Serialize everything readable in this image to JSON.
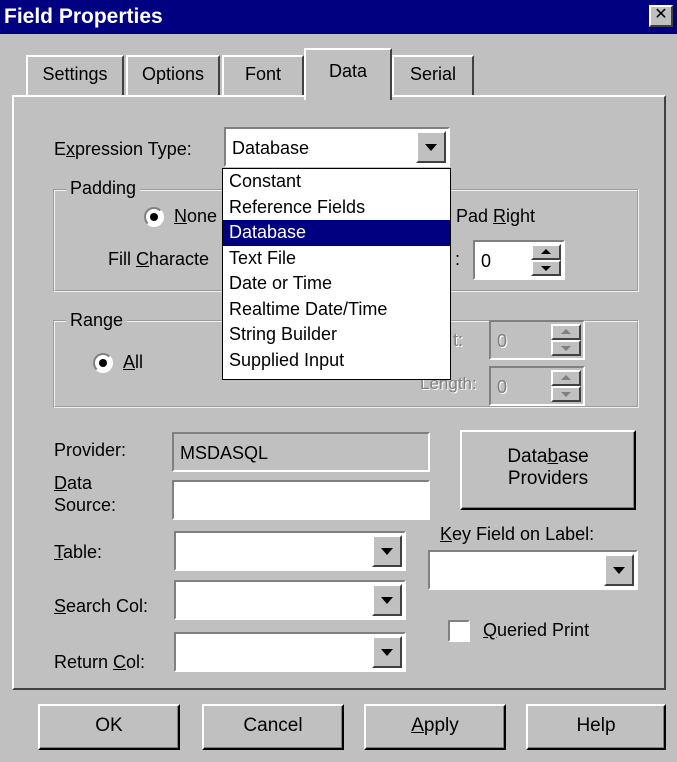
{
  "window": {
    "title": "Field Properties",
    "close_glyph": "✕"
  },
  "tabs": [
    "Settings",
    "Options",
    "Font",
    "Data",
    "Serial"
  ],
  "expression_type": {
    "label_pre": "E",
    "label_u": "x",
    "label_post": "pression Type:",
    "value": "Database",
    "options": [
      "Constant",
      "Reference Fields",
      "Database",
      "Text File",
      "Date or Time",
      "Realtime Date/Time",
      "String Builder",
      "Supplied Input"
    ],
    "selected_index": 2
  },
  "padding": {
    "legend": "Padding",
    "radio_none_u": "N",
    "radio_none_rest": "one",
    "pad_right_pre": "Pad ",
    "pad_right_u": "R",
    "pad_right_rest": "ight",
    "fill_pre": "Fill ",
    "fill_u": "C",
    "fill_rest": "haracte",
    "colon": ":",
    "spin_value": "0"
  },
  "range": {
    "legend": "Range",
    "radio_all_u": "A",
    "radio_all_rest": "ll",
    "start_partial": "t:",
    "start_value": "0",
    "length_label": "Length:",
    "length_value": "0"
  },
  "provider": {
    "label": "Provider:",
    "value": "MSDASQL"
  },
  "data_source": {
    "label_u": "D",
    "label_rest1": "ata",
    "label_line2": "Source:",
    "value": ""
  },
  "database_providers_button": {
    "line1_pre": "Data",
    "line1_u": "b",
    "line1_post": "ase",
    "line2": "Providers"
  },
  "table": {
    "label_u": "T",
    "label_rest": "able:",
    "value": ""
  },
  "search_col": {
    "label_u": "S",
    "label_rest": "earch Col:",
    "value": ""
  },
  "return_col": {
    "label_pre": "Return ",
    "label_u": "C",
    "label_rest": "ol:",
    "value": ""
  },
  "key_field": {
    "label_u": "K",
    "label_rest": "ey Field on Label:",
    "value": ""
  },
  "queried_print": {
    "label_u": "Q",
    "label_rest": "ueried Print",
    "checked": false
  },
  "buttons": {
    "ok": "OK",
    "cancel": "Cancel",
    "apply_u": "A",
    "apply_rest": "pply",
    "help": "Help"
  }
}
